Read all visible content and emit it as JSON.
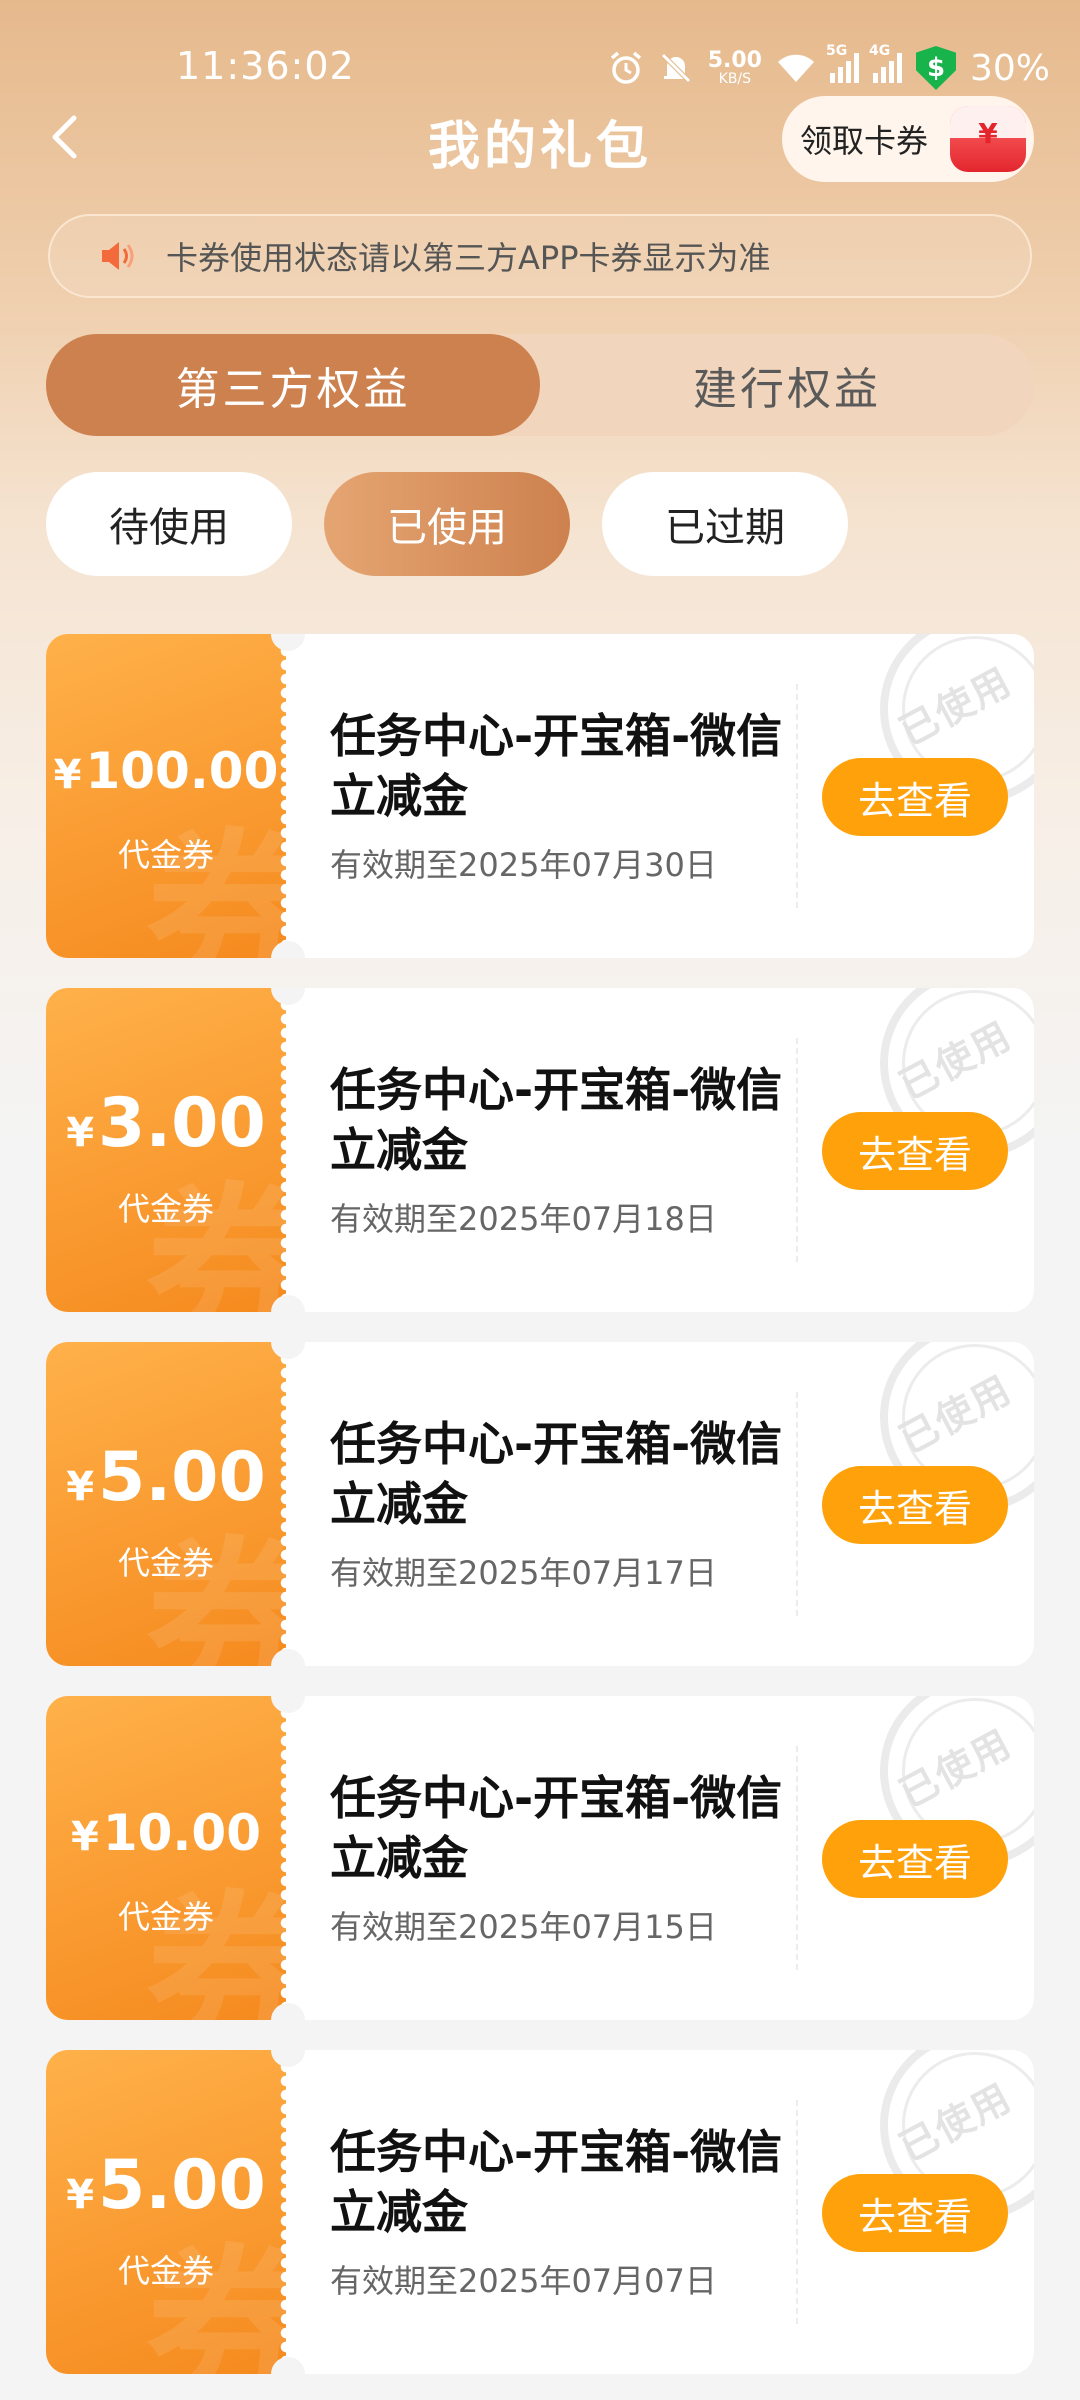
{
  "status_bar": {
    "time": "11:36:02",
    "net_speed": "5.00",
    "net_unit": "KB/S",
    "sig1_tag": "5G",
    "sig2_tag": "4G",
    "shield_symbol": "$",
    "battery": "30%"
  },
  "header": {
    "title": "我的礼包",
    "claim_label": "领取卡券",
    "claim_icon_symbol": "¥"
  },
  "notice": {
    "text": "卡券使用状态请以第三方APP卡券显示为准"
  },
  "main_tabs": [
    {
      "label": "第三方权益",
      "active": true
    },
    {
      "label": "建行权益",
      "active": false
    }
  ],
  "sub_tabs": [
    {
      "label": "待使用",
      "active": false
    },
    {
      "label": "已使用",
      "active": true
    },
    {
      "label": "已过期",
      "active": false
    }
  ],
  "coupons": [
    {
      "currency": "¥",
      "amount": "100.00",
      "type": "代金券",
      "title": "任务中心-开宝箱-微信立减金",
      "expiry": "有效期至2025年07月30日",
      "action": "去查看",
      "stamp": "已使用"
    },
    {
      "currency": "¥",
      "amount": "3.00",
      "type": "代金券",
      "title": "任务中心-开宝箱-微信立减金",
      "expiry": "有效期至2025年07月18日",
      "action": "去查看",
      "stamp": "已使用"
    },
    {
      "currency": "¥",
      "amount": "5.00",
      "type": "代金券",
      "title": "任务中心-开宝箱-微信立减金",
      "expiry": "有效期至2025年07月17日",
      "action": "去查看",
      "stamp": "已使用"
    },
    {
      "currency": "¥",
      "amount": "10.00",
      "type": "代金券",
      "title": "任务中心-开宝箱-微信立减金",
      "expiry": "有效期至2025年07月15日",
      "action": "去查看",
      "stamp": "已使用"
    },
    {
      "currency": "¥",
      "amount": "5.00",
      "type": "代金券",
      "title": "任务中心-开宝箱-微信立减金",
      "expiry": "有效期至2025年07月07日",
      "action": "去查看",
      "stamp": "已使用"
    }
  ],
  "colors": {
    "accent": "#cd814e",
    "coupon_orange": "#f58a1e",
    "button_orange": "#ffa10a"
  },
  "icons": {
    "back": "chevron-left-icon",
    "notice": "speaker-icon"
  }
}
